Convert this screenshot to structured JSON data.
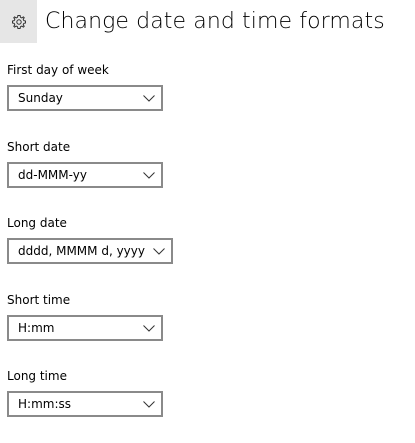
{
  "header": {
    "icon": "gear-icon",
    "title": "Change date and time formats"
  },
  "settings": [
    {
      "label": "First day of week",
      "value": "Sunday"
    },
    {
      "label": "Short date",
      "value": "dd-MMM-yy"
    },
    {
      "label": "Long date",
      "value": "dddd, MMMM d, yyyy"
    },
    {
      "label": "Short time",
      "value": "H:mm"
    },
    {
      "label": "Long time",
      "value": "H:mm:ss"
    }
  ],
  "colors": {
    "header_icon_bg": "#e6e6e6",
    "dropdown_border": "#8a8a8a",
    "text": "#000000"
  }
}
